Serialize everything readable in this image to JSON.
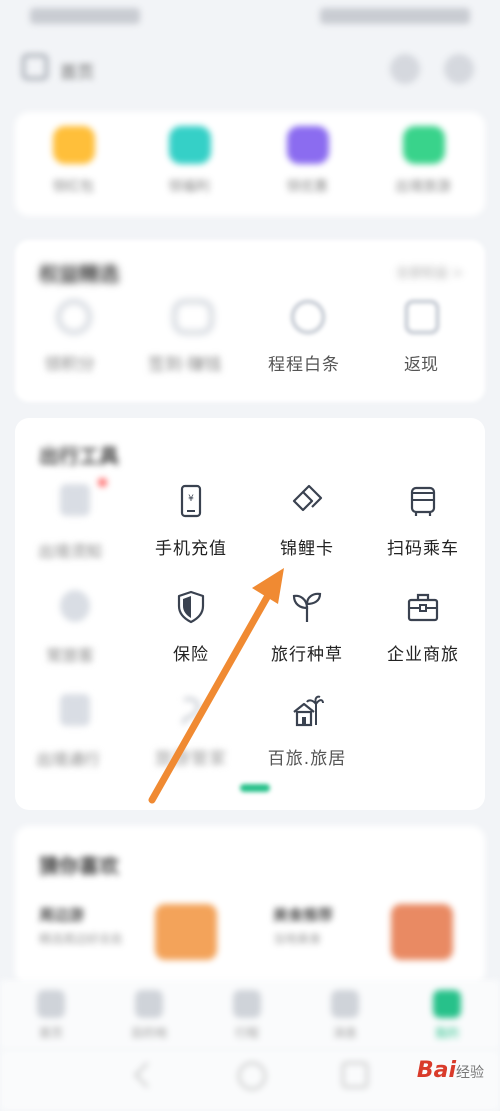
{
  "header": {
    "title": "首页"
  },
  "top_icons": [
    {
      "label": "领红包",
      "color": "#ffbf3a"
    },
    {
      "label": "领福利",
      "color": "#35d0c7"
    },
    {
      "label": "领优惠",
      "color": "#8b6cf0"
    },
    {
      "label": "出境旅游",
      "color": "#39d38b"
    }
  ],
  "section2": {
    "title": "权益精选",
    "more": "全部权益 >",
    "items": [
      "领积分",
      "签到·赚钱",
      "程程白条",
      "返现"
    ]
  },
  "section3": {
    "title": "出行工具",
    "left_column": [
      "出境须知",
      "常旅客",
      "出境通行"
    ],
    "grid": [
      {
        "label": "手机充值",
        "icon": "phone-recharge-icon"
      },
      {
        "label": "锦鲤卡",
        "icon": "koi-card-icon"
      },
      {
        "label": "扫码乘车",
        "icon": "bus-qr-icon"
      },
      {
        "label": "保险",
        "icon": "shield-icon"
      },
      {
        "label": "旅行种草",
        "icon": "sprout-icon"
      },
      {
        "label": "企业商旅",
        "icon": "briefcase-icon"
      },
      {
        "label": "旅游管家",
        "icon": "butler-icon"
      },
      {
        "label": "百旅.旅居",
        "icon": "palm-house-icon"
      }
    ]
  },
  "section4": {
    "title": "猜你喜欢",
    "left_title": "周边游",
    "left_sub": "精选周边好去处",
    "right_title": "美食推荐",
    "right_sub": "当地美食"
  },
  "bottom_nav": [
    "首页",
    "目的地",
    "行程",
    "消息",
    "我的"
  ],
  "watermark": {
    "brand": "Bai",
    "suffix": "经验"
  },
  "colors": {
    "accent": "#27c18a",
    "arrow": "#f08a32"
  }
}
